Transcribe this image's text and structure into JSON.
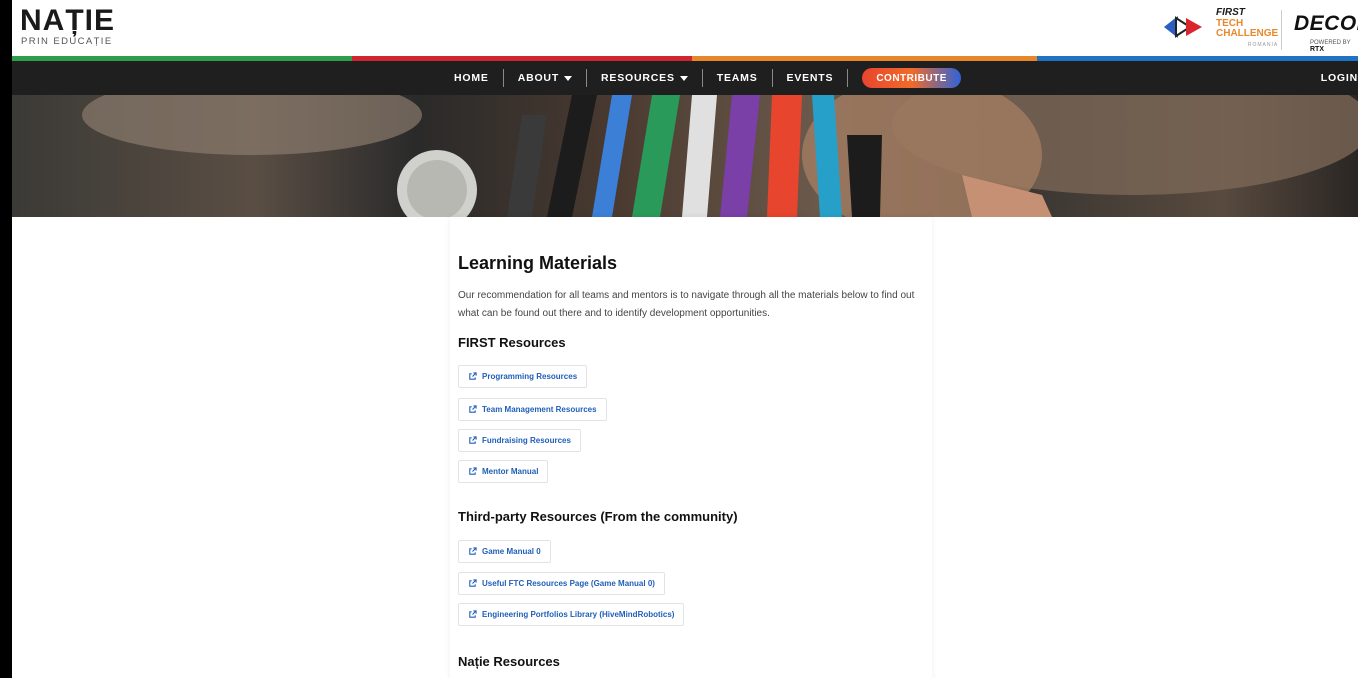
{
  "header": {
    "logo_main": "NAȚIE",
    "logo_sub": "PRIN EDUCAȚIE",
    "ftc": {
      "first": "FIRST",
      "tech": "TECH",
      "challenge": "CHALLENGE",
      "region": "ROMANIA"
    },
    "decode": "DECODE",
    "decode_powered": "POWERED BY",
    "decode_sponsor": "RTX"
  },
  "nav": {
    "home": "HOME",
    "about": "ABOUT",
    "resources": "RESOURCES",
    "teams": "TEAMS",
    "events": "EVENTS",
    "contribute": "CONTRIBUTE",
    "login": "LOGIN"
  },
  "main": {
    "title": "Learning Materials",
    "intro": "Our recommendation for all teams and mentors is to navigate through all the materials below to find out what can be found out there and to identify development opportunities.",
    "sections": [
      {
        "heading": "FIRST Resources",
        "links": [
          "Programming Resources",
          "Team Management Resources",
          "Fundraising Resources",
          "Mentor Manual"
        ]
      },
      {
        "heading": "Third-party Resources (From the community)",
        "links": [
          "Game Manual 0",
          "Useful FTC Resources Page (Game Manual 0)",
          "Engineering Portfolios Library (HiveMindRobotics)"
        ]
      },
      {
        "heading": "Nație Resources",
        "links": []
      }
    ]
  },
  "colors": {
    "stripe": [
      "#2e9e4a",
      "#d0252d",
      "#e8862a",
      "#1f72c4"
    ],
    "nav_bg": "#1f1f1f",
    "link": "#1f5fb8"
  },
  "icons": {
    "resource_link": "external-link-icon",
    "nav_dropdown": "caret-down-icon"
  }
}
